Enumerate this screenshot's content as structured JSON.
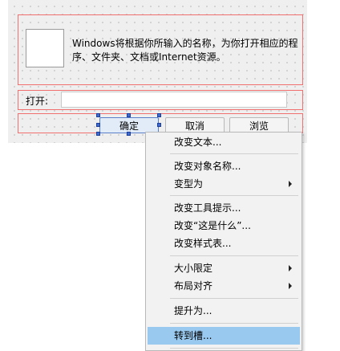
{
  "dialog": {
    "description": "Windows将根据你所输入的名称，为你打开相应的程序、文件夹、文档或Internet资源。",
    "open_label": "打开:",
    "open_value": "",
    "ok_label": "确定",
    "cancel_label": "取消",
    "browse_label": "浏览"
  },
  "context_menu": {
    "items": [
      {
        "label": "改变文本...",
        "submenu": false
      },
      {
        "label": "改变对象名称...",
        "submenu": false
      },
      {
        "label": "变型为",
        "submenu": true
      },
      {
        "label": "改变工具提示...",
        "submenu": false
      },
      {
        "label": "改变“这是什么”...",
        "submenu": false
      },
      {
        "label": "改变样式表...",
        "submenu": false
      },
      {
        "label": "大小限定",
        "submenu": true
      },
      {
        "label": "布局对齐",
        "submenu": true
      },
      {
        "label": "提升为...",
        "submenu": false
      },
      {
        "label": "转到槽...",
        "submenu": false,
        "highlighted": true
      }
    ]
  },
  "colors": {
    "layout_border": "#f07070",
    "menu_highlight": "#99c9ef",
    "selection_handle": "#3f6ad0"
  }
}
